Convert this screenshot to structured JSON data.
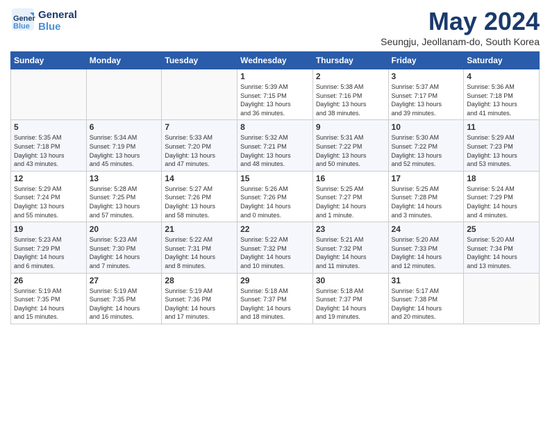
{
  "header": {
    "logo_line1": "General",
    "logo_line2": "Blue",
    "month": "May 2024",
    "location": "Seungju, Jeollanam-do, South Korea"
  },
  "weekdays": [
    "Sunday",
    "Monday",
    "Tuesday",
    "Wednesday",
    "Thursday",
    "Friday",
    "Saturday"
  ],
  "weeks": [
    [
      {
        "day": "",
        "info": ""
      },
      {
        "day": "",
        "info": ""
      },
      {
        "day": "",
        "info": ""
      },
      {
        "day": "1",
        "info": "Sunrise: 5:39 AM\nSunset: 7:15 PM\nDaylight: 13 hours\nand 36 minutes."
      },
      {
        "day": "2",
        "info": "Sunrise: 5:38 AM\nSunset: 7:16 PM\nDaylight: 13 hours\nand 38 minutes."
      },
      {
        "day": "3",
        "info": "Sunrise: 5:37 AM\nSunset: 7:17 PM\nDaylight: 13 hours\nand 39 minutes."
      },
      {
        "day": "4",
        "info": "Sunrise: 5:36 AM\nSunset: 7:18 PM\nDaylight: 13 hours\nand 41 minutes."
      }
    ],
    [
      {
        "day": "5",
        "info": "Sunrise: 5:35 AM\nSunset: 7:18 PM\nDaylight: 13 hours\nand 43 minutes."
      },
      {
        "day": "6",
        "info": "Sunrise: 5:34 AM\nSunset: 7:19 PM\nDaylight: 13 hours\nand 45 minutes."
      },
      {
        "day": "7",
        "info": "Sunrise: 5:33 AM\nSunset: 7:20 PM\nDaylight: 13 hours\nand 47 minutes."
      },
      {
        "day": "8",
        "info": "Sunrise: 5:32 AM\nSunset: 7:21 PM\nDaylight: 13 hours\nand 48 minutes."
      },
      {
        "day": "9",
        "info": "Sunrise: 5:31 AM\nSunset: 7:22 PM\nDaylight: 13 hours\nand 50 minutes."
      },
      {
        "day": "10",
        "info": "Sunrise: 5:30 AM\nSunset: 7:22 PM\nDaylight: 13 hours\nand 52 minutes."
      },
      {
        "day": "11",
        "info": "Sunrise: 5:29 AM\nSunset: 7:23 PM\nDaylight: 13 hours\nand 53 minutes."
      }
    ],
    [
      {
        "day": "12",
        "info": "Sunrise: 5:29 AM\nSunset: 7:24 PM\nDaylight: 13 hours\nand 55 minutes."
      },
      {
        "day": "13",
        "info": "Sunrise: 5:28 AM\nSunset: 7:25 PM\nDaylight: 13 hours\nand 57 minutes."
      },
      {
        "day": "14",
        "info": "Sunrise: 5:27 AM\nSunset: 7:26 PM\nDaylight: 13 hours\nand 58 minutes."
      },
      {
        "day": "15",
        "info": "Sunrise: 5:26 AM\nSunset: 7:26 PM\nDaylight: 14 hours\nand 0 minutes."
      },
      {
        "day": "16",
        "info": "Sunrise: 5:25 AM\nSunset: 7:27 PM\nDaylight: 14 hours\nand 1 minute."
      },
      {
        "day": "17",
        "info": "Sunrise: 5:25 AM\nSunset: 7:28 PM\nDaylight: 14 hours\nand 3 minutes."
      },
      {
        "day": "18",
        "info": "Sunrise: 5:24 AM\nSunset: 7:29 PM\nDaylight: 14 hours\nand 4 minutes."
      }
    ],
    [
      {
        "day": "19",
        "info": "Sunrise: 5:23 AM\nSunset: 7:29 PM\nDaylight: 14 hours\nand 6 minutes."
      },
      {
        "day": "20",
        "info": "Sunrise: 5:23 AM\nSunset: 7:30 PM\nDaylight: 14 hours\nand 7 minutes."
      },
      {
        "day": "21",
        "info": "Sunrise: 5:22 AM\nSunset: 7:31 PM\nDaylight: 14 hours\nand 8 minutes."
      },
      {
        "day": "22",
        "info": "Sunrise: 5:22 AM\nSunset: 7:32 PM\nDaylight: 14 hours\nand 10 minutes."
      },
      {
        "day": "23",
        "info": "Sunrise: 5:21 AM\nSunset: 7:32 PM\nDaylight: 14 hours\nand 11 minutes."
      },
      {
        "day": "24",
        "info": "Sunrise: 5:20 AM\nSunset: 7:33 PM\nDaylight: 14 hours\nand 12 minutes."
      },
      {
        "day": "25",
        "info": "Sunrise: 5:20 AM\nSunset: 7:34 PM\nDaylight: 14 hours\nand 13 minutes."
      }
    ],
    [
      {
        "day": "26",
        "info": "Sunrise: 5:19 AM\nSunset: 7:35 PM\nDaylight: 14 hours\nand 15 minutes."
      },
      {
        "day": "27",
        "info": "Sunrise: 5:19 AM\nSunset: 7:35 PM\nDaylight: 14 hours\nand 16 minutes."
      },
      {
        "day": "28",
        "info": "Sunrise: 5:19 AM\nSunset: 7:36 PM\nDaylight: 14 hours\nand 17 minutes."
      },
      {
        "day": "29",
        "info": "Sunrise: 5:18 AM\nSunset: 7:37 PM\nDaylight: 14 hours\nand 18 minutes."
      },
      {
        "day": "30",
        "info": "Sunrise: 5:18 AM\nSunset: 7:37 PM\nDaylight: 14 hours\nand 19 minutes."
      },
      {
        "day": "31",
        "info": "Sunrise: 5:17 AM\nSunset: 7:38 PM\nDaylight: 14 hours\nand 20 minutes."
      },
      {
        "day": "",
        "info": ""
      }
    ]
  ]
}
